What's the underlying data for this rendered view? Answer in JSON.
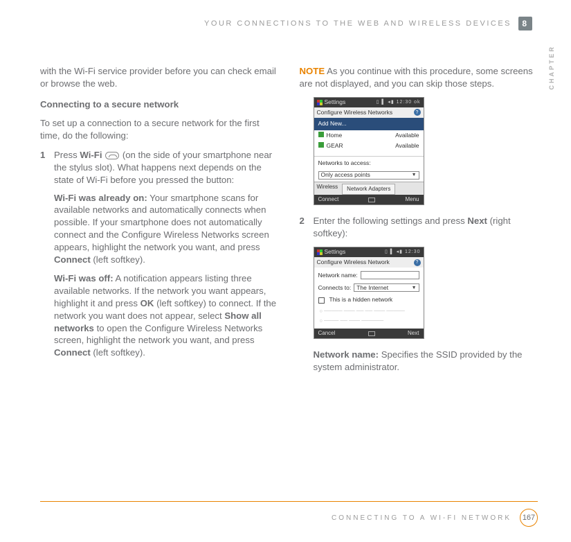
{
  "header": {
    "title": "YOUR CONNECTIONS TO THE WEB AND WIRELESS DEVICES",
    "chapter_num": "8",
    "chapter_label": "CHAPTER"
  },
  "left": {
    "intro": "with the Wi-Fi service provider before you can check email or browse the web.",
    "section_title": "Connecting to a secure network",
    "section_intro": "To set up a connection to a secure network for the first time, do the following:",
    "step1_num": "1",
    "step1_a": "Press ",
    "step1_b": "Wi-Fi",
    "step1_c": " (on the side of your smartphone near the stylus slot). What happens next depends on the state of Wi-Fi before you pressed the button:",
    "on_title": "Wi-Fi was already on:",
    "on_body_a": " Your smartphone scans for available networks and automatically connects when possible. If your smartphone does not automatically connect and the Configure Wireless Networks screen appears, highlight the network you want, and press ",
    "on_body_b": "Connect",
    "on_body_c": " (left softkey).",
    "off_title": "Wi-Fi was off:",
    "off_body_a": " A notification appears listing three available networks. If the network you want appears, highlight it and press ",
    "off_body_b": "OK",
    "off_body_c": " (left softkey) to connect. If the network you want does not appear, select ",
    "off_body_d": "Show all networks",
    "off_body_e": " to open the Configure Wireless Networks screen, highlight the network you want, and press ",
    "off_body_f": "Connect",
    "off_body_g": " (left softkey)."
  },
  "right": {
    "note_label": "NOTE",
    "note_body": " As you continue with this procedure, some screens are not displayed, and you can skip those steps.",
    "step2_num": "2",
    "step2_a": "Enter the following settings and press ",
    "step2_b": "Next",
    "step2_c": " (right softkey):",
    "netname_label": "Network name:",
    "netname_body": " Specifies the SSID provided by the system administrator."
  },
  "shot1": {
    "title": "Settings",
    "time": "12:30",
    "subtitle": "Configure Wireless Networks",
    "add_new": "Add New...",
    "row1_name": "Home",
    "row1_status": "Available",
    "row2_name": "GEAR",
    "row2_status": "Available",
    "access_label": "Networks to access:",
    "access_value": "Only access points",
    "tab1": "Wireless",
    "tab2": "Network Adapters",
    "left_soft": "Connect",
    "right_soft": "Menu"
  },
  "shot2": {
    "title": "Settings",
    "time": "12:30",
    "subtitle": "Configure Wireless Network",
    "name_label": "Network name:",
    "connects_label": "Connects to:",
    "connects_value": "The Internet",
    "hidden_label": "This is a hidden network",
    "left_soft": "Cancel",
    "right_soft": "Next"
  },
  "footer": {
    "title": "CONNECTING TO A WI-FI NETWORK",
    "page": "167"
  }
}
